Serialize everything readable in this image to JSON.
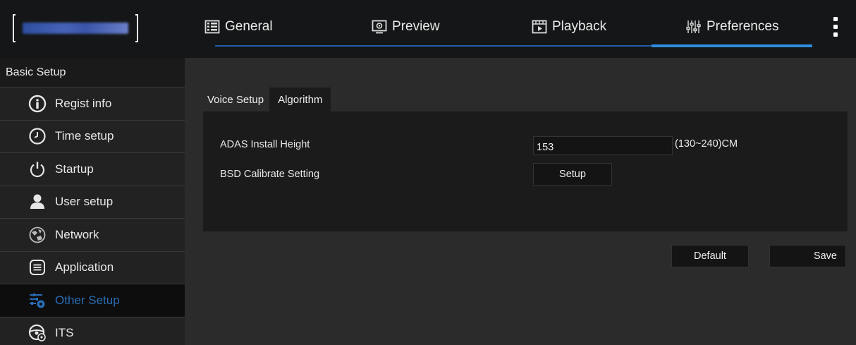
{
  "header": {
    "tabs": [
      {
        "label": "General",
        "icon": "general-icon"
      },
      {
        "label": "Preview",
        "icon": "preview-icon"
      },
      {
        "label": "Playback",
        "icon": "playback-icon"
      },
      {
        "label": "Preferences",
        "icon": "preferences-icon"
      }
    ],
    "active_tab": "Preferences",
    "accent_color": "#2d8de0"
  },
  "sidebar": {
    "header": "Basic Setup",
    "items": [
      {
        "label": "Regist info",
        "icon": "info-icon"
      },
      {
        "label": "Time setup",
        "icon": "clock-icon"
      },
      {
        "label": "Startup",
        "icon": "power-icon"
      },
      {
        "label": "User setup",
        "icon": "user-icon"
      },
      {
        "label": "Network",
        "icon": "network-icon"
      },
      {
        "label": "Application",
        "icon": "application-icon"
      },
      {
        "label": "Other Setup",
        "icon": "sliders-gear-icon"
      },
      {
        "label": "ITS",
        "icon": "steering-wheel-icon"
      }
    ],
    "active_item": "Other Setup",
    "active_color": "#2a6db5"
  },
  "main": {
    "subtabs": [
      {
        "label": "Voice Setup"
      },
      {
        "label": "Algorithm"
      }
    ],
    "active_subtab": "Algorithm",
    "fields": {
      "adas_label": "ADAS Install Height",
      "adas_value": "153",
      "adas_range": "(130~240)CM",
      "bsd_label": "BSD Calibrate Setting",
      "bsd_button": "Setup"
    },
    "buttons": {
      "default": "Default",
      "save": "Save"
    }
  }
}
